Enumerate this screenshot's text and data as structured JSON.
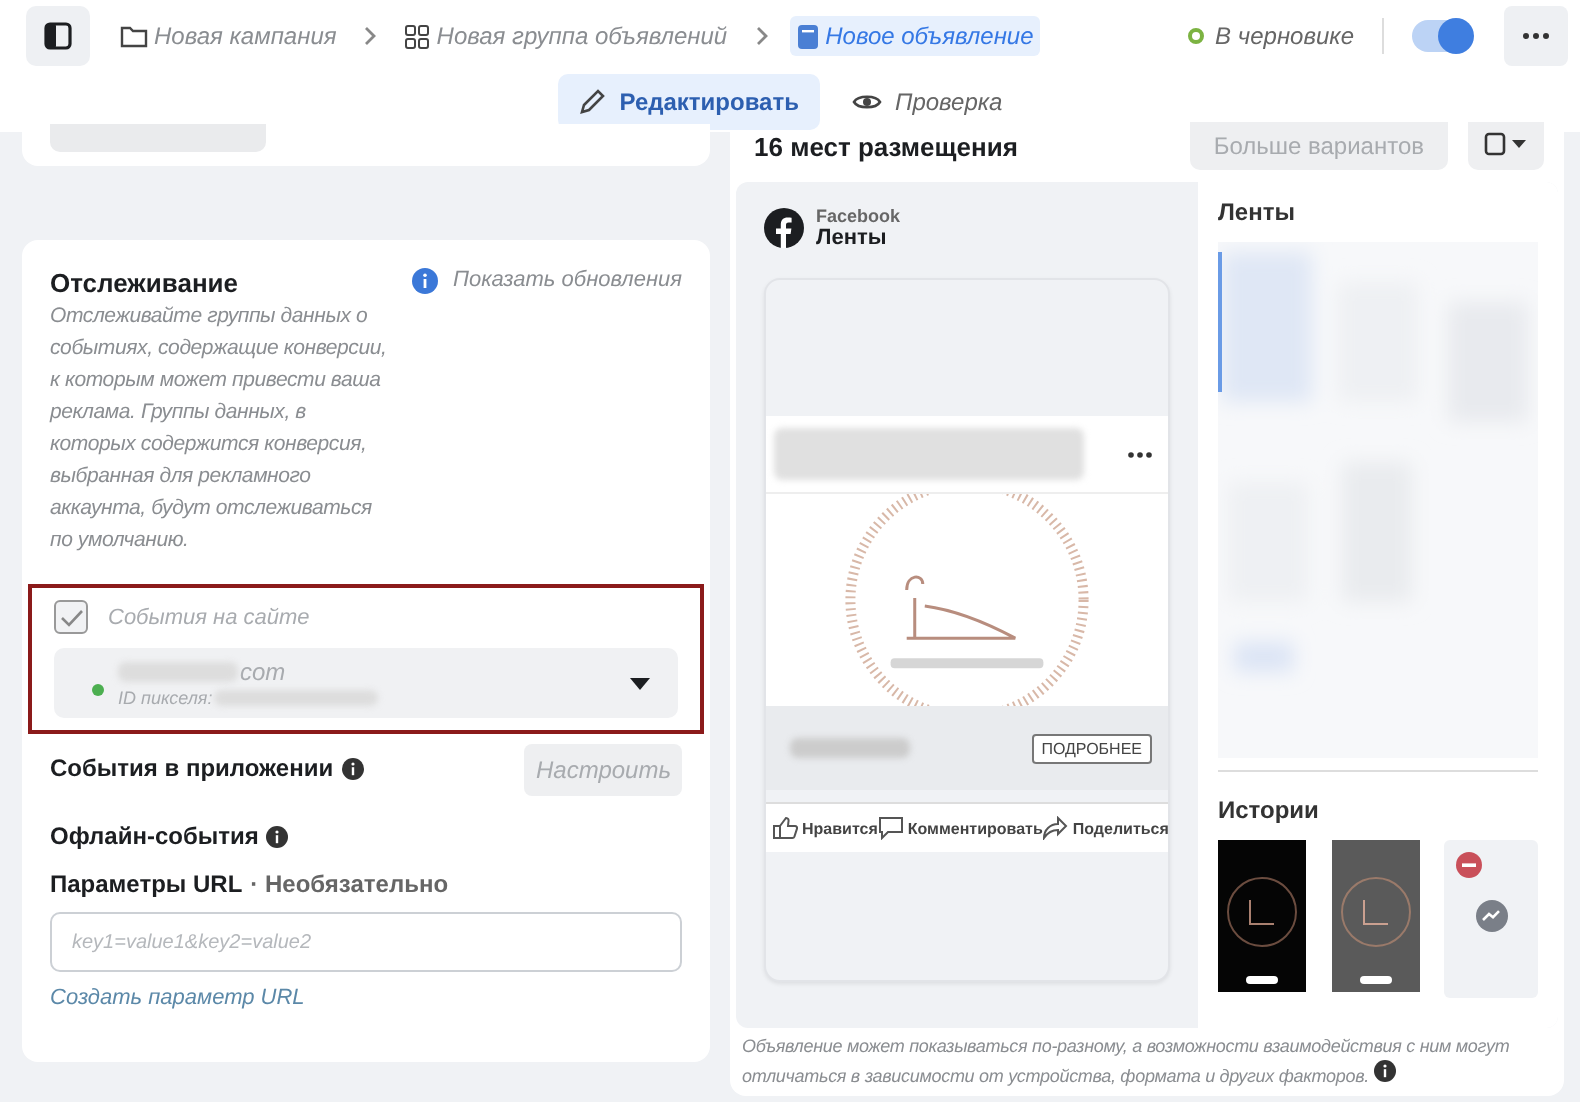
{
  "topbar": {
    "breadcrumbs": [
      {
        "label": "Новая кампания",
        "kind": "folder",
        "selected": false
      },
      {
        "label": "Новая группа объявлений",
        "kind": "grid",
        "selected": false
      },
      {
        "label": "Новое объявление",
        "kind": "doc",
        "selected": true
      }
    ],
    "status": {
      "label": "В черновике",
      "color": "#7cb342"
    },
    "toggle_on": true
  },
  "mode_tabs": [
    {
      "label": "Редактировать",
      "kind": "pencil",
      "selected": true
    },
    {
      "label": "Проверка",
      "kind": "eye",
      "selected": false
    }
  ],
  "tracking": {
    "title": "Отслеживание",
    "description": "Отслеживайте группы данных о событиях, содержащие конверсии, к которым может привести ваша реклама. Группы данных, в которых содержится конверсия, выбранная для рекламного аккаунта, будут отслеживаться по умолчанию.",
    "updates_link": "Показать обновления",
    "website_events": {
      "label": "События на сайте",
      "checked": true,
      "disabled": true
    },
    "pixel": {
      "name": "com",
      "id_label": "ID пикселя:",
      "color": "#4caf50"
    },
    "app_events": {
      "label": "События в приложении",
      "button": "Настроить"
    },
    "offline_events": {
      "label": "Офлайн-события"
    },
    "url_params": {
      "label": "Параметры URL",
      "optional": "· Необязательно",
      "placeholder": "key1=value1&key2=value2",
      "link": "Создать параметр URL"
    }
  },
  "preview": {
    "title": "16 мест размещения",
    "more_button": "Больше вариантов",
    "platform": "Facebook",
    "placement": "Ленты",
    "cta": "ПОДРОБНЕЕ",
    "actions": [
      {
        "label": "Нравится",
        "kind": "like"
      },
      {
        "label": "Комментировать",
        "kind": "comment"
      },
      {
        "label": "Поделиться",
        "kind": "share"
      }
    ],
    "side_sections": [
      {
        "title": "Ленты"
      },
      {
        "title": "Истории"
      }
    ],
    "disclaimer": "Объявление может показываться по-разному, а возможности взаимодействия с ним могут отличаться в зависимости от устройства, формата и других факторов."
  }
}
